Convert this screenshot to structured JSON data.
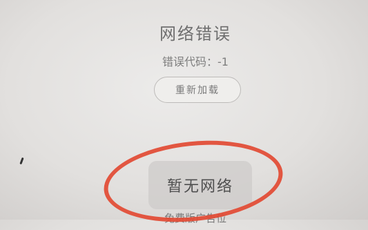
{
  "error": {
    "title": "网络错误",
    "code_text": "错误代码：-1",
    "reload_label": "重新加载"
  },
  "toast": {
    "message": "暂无网络"
  },
  "footer": {
    "partial_text": "免费版广告位"
  },
  "colors": {
    "annotation": "#e24a33",
    "background": "#e2e0de"
  }
}
